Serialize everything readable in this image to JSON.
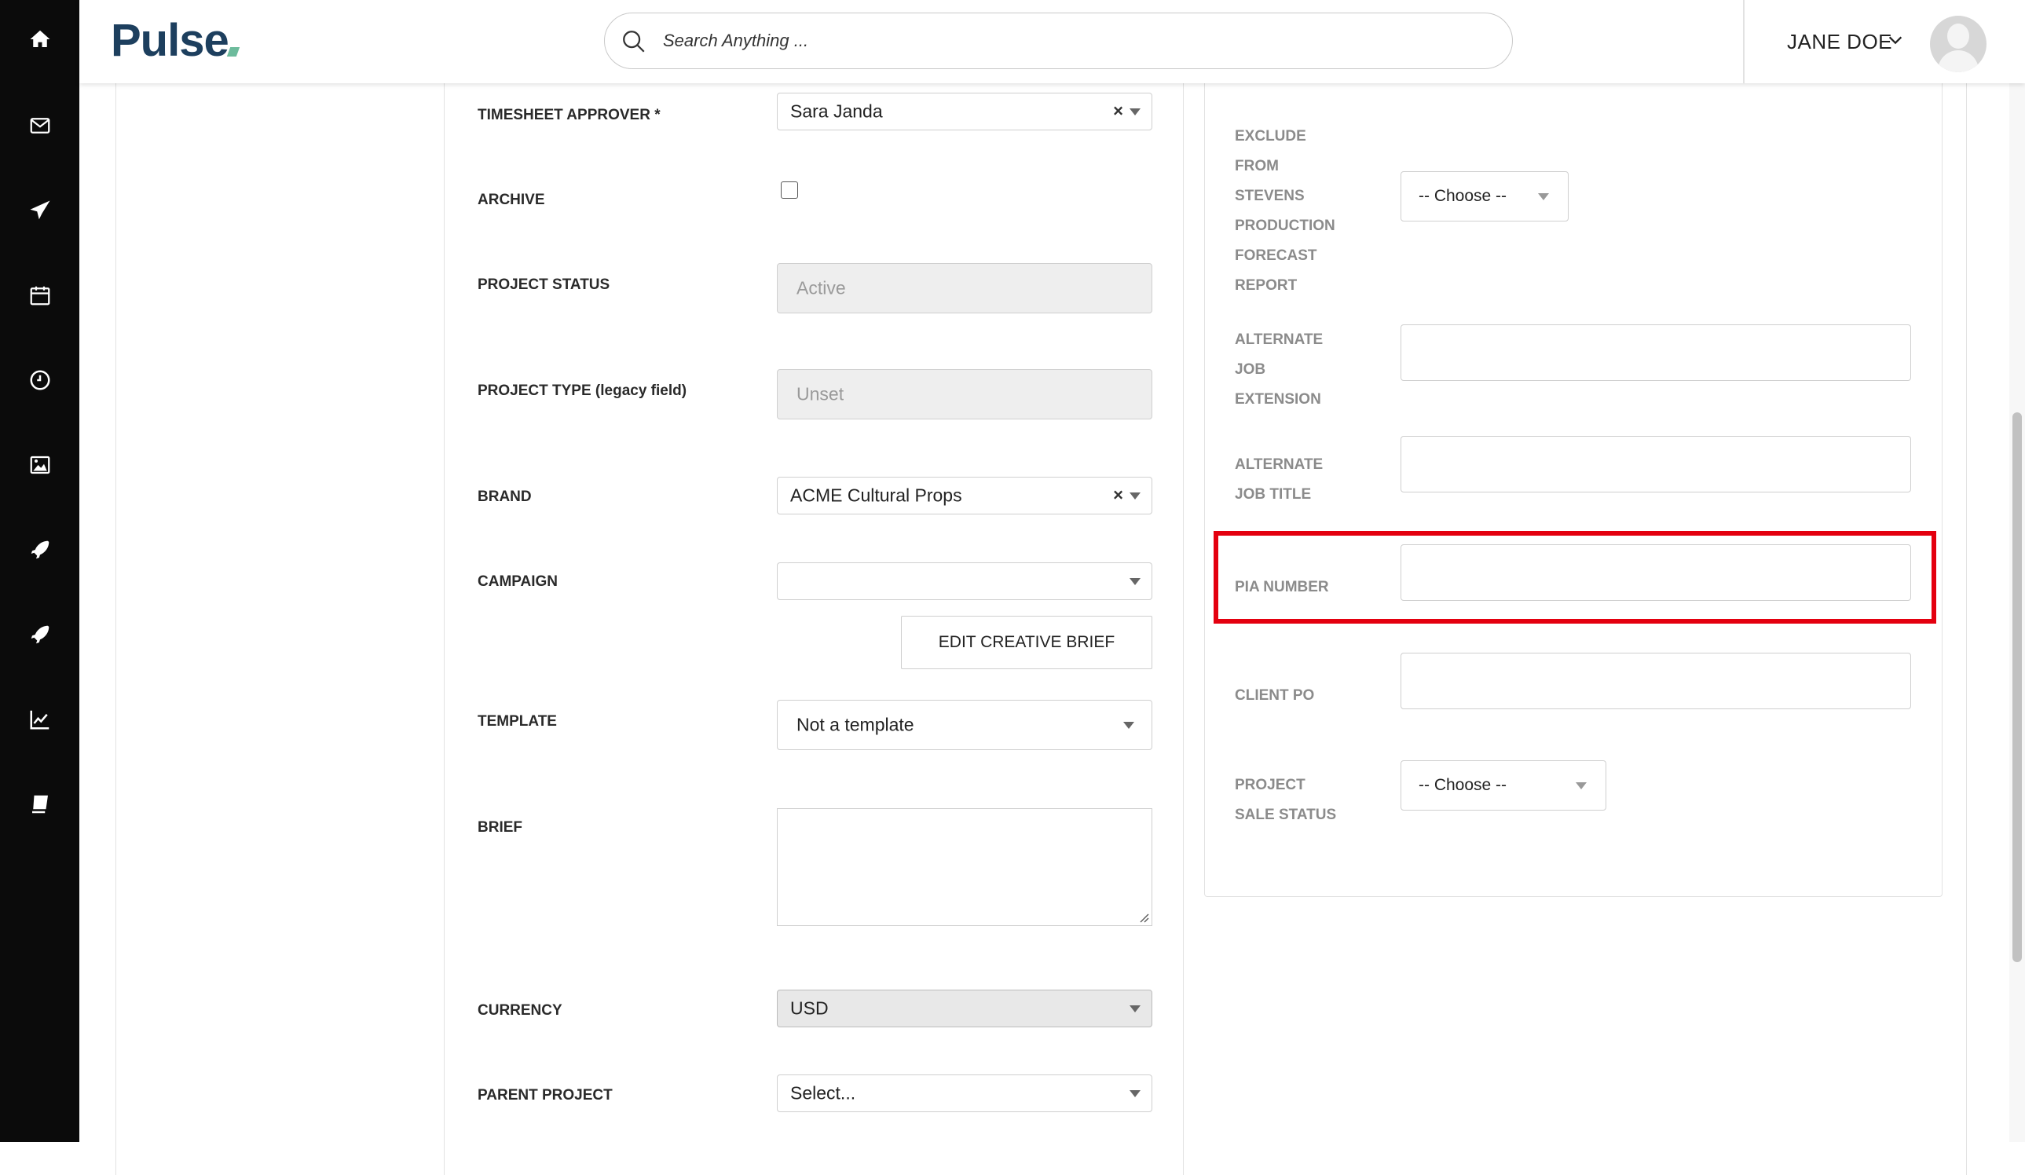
{
  "app": {
    "logo_text": "Pulse"
  },
  "search": {
    "placeholder": "Search Anything ..."
  },
  "user": {
    "name": "JANE DOE"
  },
  "sidebar": {
    "icons": [
      "home-icon",
      "mail-icon",
      "paper-plane-icon",
      "calendar-icon",
      "clock-icon",
      "image-icon",
      "rocket-icon",
      "rocket-icon-2",
      "chart-icon",
      "book-icon"
    ]
  },
  "left_form": {
    "timesheet_approver": {
      "label": "TIMESHEET APPROVER *",
      "value": "Sara Janda"
    },
    "archive": {
      "label": "ARCHIVE",
      "checked": false
    },
    "project_status": {
      "label": "PROJECT STATUS",
      "value": "Active"
    },
    "project_type": {
      "label": "PROJECT TYPE (legacy field)",
      "value": "Unset"
    },
    "brand": {
      "label": "BRAND",
      "value": "ACME Cultural Props"
    },
    "campaign": {
      "label": "CAMPAIGN",
      "value": ""
    },
    "edit_creative_brief": {
      "label": "EDIT CREATIVE BRIEF"
    },
    "template": {
      "label": "TEMPLATE",
      "value": "Not a template"
    },
    "brief": {
      "label": "BRIEF",
      "value": ""
    },
    "currency": {
      "label": "CURRENCY",
      "value": "USD"
    },
    "parent_project": {
      "label": "PARENT PROJECT",
      "value": "Select..."
    }
  },
  "right_form": {
    "exclude_report": {
      "label_lines": [
        "EXCLUDE",
        "FROM",
        "STEVENS",
        "PRODUCTION",
        "FORECAST",
        "REPORT"
      ],
      "value": "-- Choose --"
    },
    "alternate_job_extension": {
      "label_lines": [
        "ALTERNATE",
        "JOB",
        "EXTENSION"
      ],
      "value": ""
    },
    "alternate_job_title": {
      "label_lines": [
        "ALTERNATE",
        "JOB TITLE"
      ],
      "value": ""
    },
    "pia_number": {
      "label": "PIA NUMBER",
      "value": ""
    },
    "client_po": {
      "label": "CLIENT PO",
      "value": ""
    },
    "project_sale_status": {
      "label_lines": [
        "PROJECT",
        "SALE STATUS"
      ],
      "value": "-- Choose --"
    }
  },
  "colors": {
    "sidebar_bg": "#0b0b0b",
    "logo": "#1d3f5e",
    "highlight": "#e4000f"
  }
}
